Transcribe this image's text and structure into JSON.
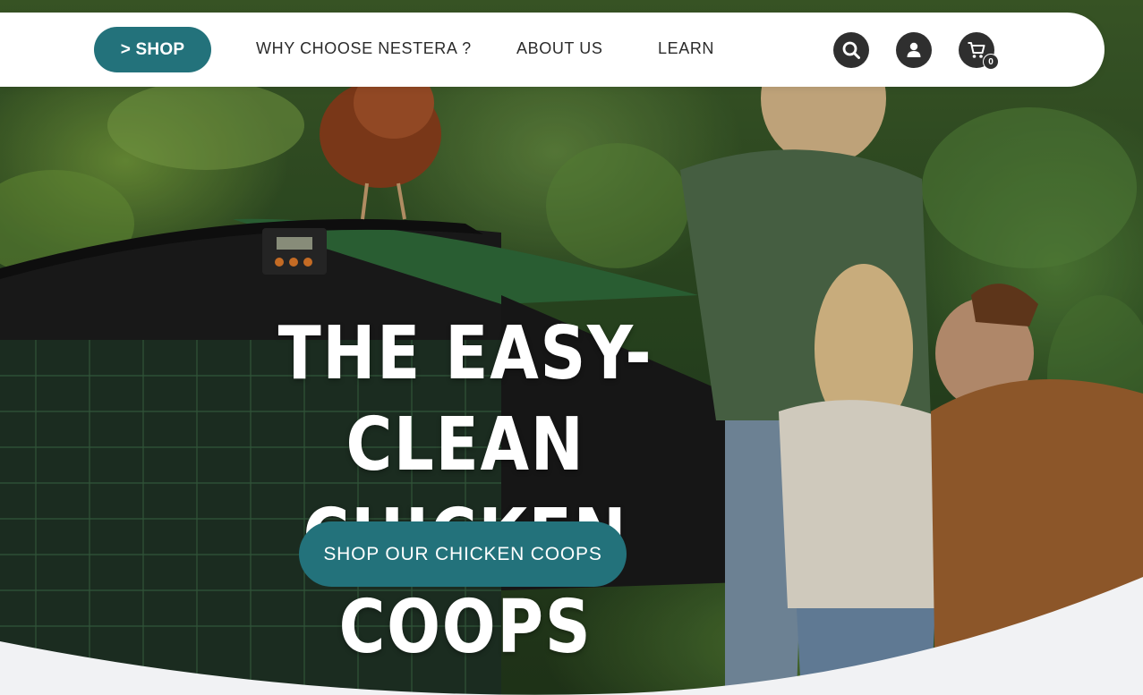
{
  "nav": {
    "shop_label": "> SHOP",
    "links": [
      {
        "label": "WHY CHOOSE NESTERA ?"
      },
      {
        "label": "ABOUT US"
      },
      {
        "label": "LEARN"
      }
    ],
    "search_icon": "search-icon",
    "account_icon": "user-icon",
    "cart_icon": "cart-icon",
    "cart_count": "0"
  },
  "hero": {
    "headline_line1": "THE EASY-CLEAN",
    "headline_line2": "CHICKEN COOPS",
    "cta_label": "SHOP OUR CHICKEN COOPS"
  },
  "colors": {
    "brand_teal": "#23727b",
    "icon_dark": "#2f2f2f",
    "nav_bg": "#ffffff",
    "wave": "#f1f2f4"
  }
}
